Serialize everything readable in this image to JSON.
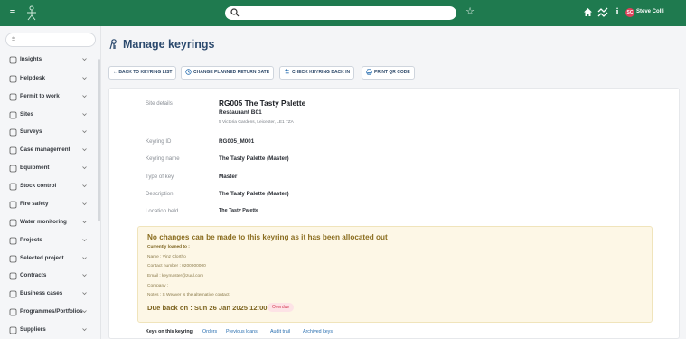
{
  "topbar": {
    "search_placeholder": "",
    "user_initials": "SC",
    "user_name": "Steve Colli"
  },
  "sidebar": {
    "filter_placeholder": "",
    "items": [
      {
        "label": "Insights",
        "icon": "insights-icon"
      },
      {
        "label": "Helpdesk",
        "icon": "helpdesk-icon"
      },
      {
        "label": "Permit to work",
        "icon": "permit-icon"
      },
      {
        "label": "Sites",
        "icon": "sites-icon"
      },
      {
        "label": "Surveys",
        "icon": "surveys-icon"
      },
      {
        "label": "Case management",
        "icon": "case-icon"
      },
      {
        "label": "Equipment",
        "icon": "equipment-icon"
      },
      {
        "label": "Stock control",
        "icon": "cart-icon"
      },
      {
        "label": "Fire safety",
        "icon": "fire-icon"
      },
      {
        "label": "Water monitoring",
        "icon": "water-icon"
      },
      {
        "label": "Projects",
        "icon": "projects-icon"
      },
      {
        "label": "Selected project",
        "icon": "selected-project-icon"
      },
      {
        "label": "Contracts",
        "icon": "contracts-icon"
      },
      {
        "label": "Business cases",
        "icon": "business-icon"
      },
      {
        "label": "Programmes/Portfolios",
        "icon": "programmes-icon"
      },
      {
        "label": "Suppliers",
        "icon": "suppliers-icon"
      }
    ]
  },
  "page": {
    "title": "Manage keyrings"
  },
  "actions": {
    "back": "← BACK TO KEYRING LIST",
    "change_date": "CHANGE PLANNED RETURN DATE",
    "check_back": "CHECK KEYRING BACK IN",
    "print_qr": "PRINT QR CODE"
  },
  "details": {
    "site_label": "Site details",
    "site_name": "RG005 The Tasty Palette",
    "site_sub": "Restaurant B01",
    "site_address": "5 Victoria Gardens, Leicester, LE1 7ZA",
    "keyring_id_label": "Keyring ID",
    "keyring_id": "RG005_M001",
    "keyring_name_label": "Keyring name",
    "keyring_name": "The Tasty Palette (Master)",
    "type_label": "Type of key",
    "type": "Master",
    "description_label": "Description",
    "description": "The Tasty Palette (Master)",
    "location_label": "Location held",
    "location": "The Tasty Palette"
  },
  "warning": {
    "title": "No changes can be made to this keyring as it has been allocated out",
    "loaned_to": "Currently loaned to :",
    "name": "Name : Vinz Clortho",
    "contact": "Contact number : 0200000000",
    "email": "Email : keymaster@zuul.com",
    "company": "Company :",
    "notes": "Notes : S Weaver is the alternative contact",
    "due": "Due back on : Sun 26 Jan 2025 12:00 PM",
    "status": "Overdue",
    "status_color": "#d4364f"
  },
  "tabs": [
    {
      "label": "Keys on this keyring"
    },
    {
      "label": "Orders"
    },
    {
      "label": "Previous loans"
    },
    {
      "label": "Audit trail"
    },
    {
      "label": "Archived keys"
    }
  ],
  "colors": {
    "brand": "#1f7a4f",
    "title": "#2c4a6e",
    "warning_bg": "#fdf7e6"
  }
}
